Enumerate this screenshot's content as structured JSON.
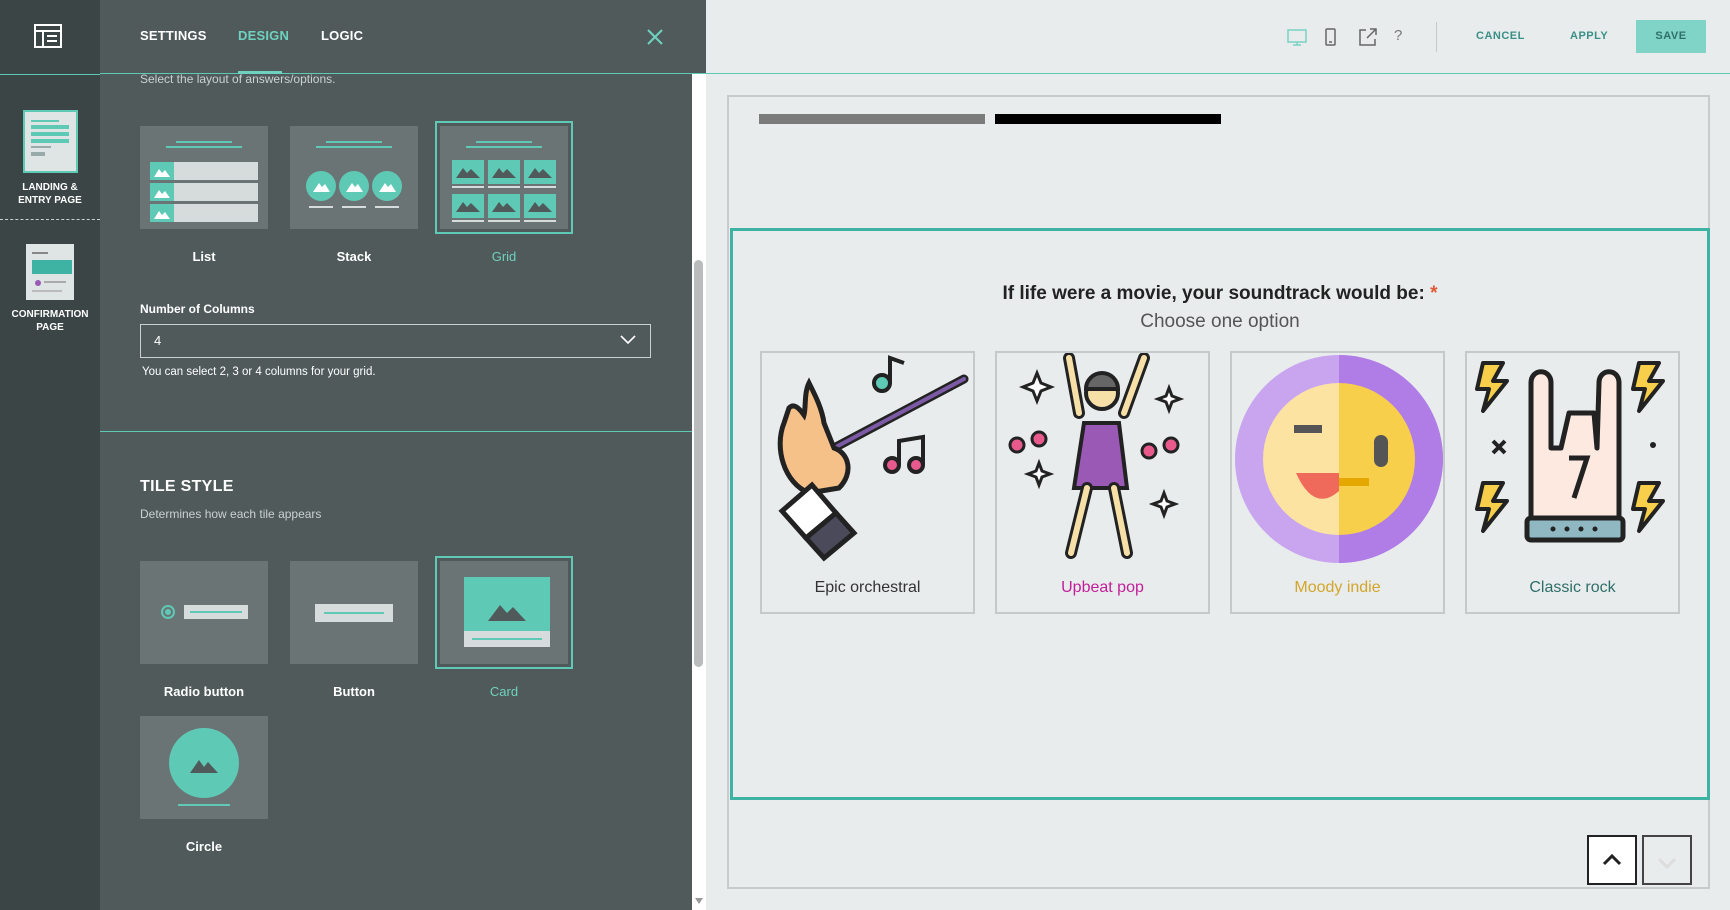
{
  "rail": {
    "pages": [
      {
        "label_line1": "LANDING &",
        "label_line2": "ENTRY PAGE"
      },
      {
        "label_line1": "CONFIRMATION",
        "label_line2": "PAGE"
      }
    ]
  },
  "panel": {
    "tabs": [
      "SETTINGS",
      "DESIGN",
      "LOGIC"
    ],
    "active_tab": "DESIGN",
    "layout_hint": "Select the layout of answers/options.",
    "layout_options": [
      "List",
      "Stack",
      "Grid"
    ],
    "layout_selected": "Grid",
    "columns_label": "Number of Columns",
    "columns_value": "4",
    "columns_help": "You can select 2, 3 or 4 columns for your grid.",
    "tile_style_title": "TILE STYLE",
    "tile_style_desc": "Determines how each tile appears",
    "tile_options": [
      "Radio button",
      "Button",
      "Card",
      "Circle"
    ],
    "tile_selected": "Card"
  },
  "topbar": {
    "cancel": "CANCEL",
    "apply": "APPLY",
    "save": "SAVE",
    "help": "?"
  },
  "preview": {
    "question": "If life were a movie, your soundtrack would be:",
    "required_mark": "*",
    "subtitle": "Choose one option",
    "answers": [
      {
        "label": "Epic orchestral",
        "color": "#333333"
      },
      {
        "label": "Upbeat pop",
        "color": "#c21f9a"
      },
      {
        "label": "Moody indie",
        "color": "#d4a52b"
      },
      {
        "label": "Classic rock",
        "color": "#2f6f6a"
      }
    ]
  },
  "colors": {
    "accent": "#5ec9b5",
    "panel_bg": "#505a5a",
    "rail_bg": "#3b4545",
    "save_bg": "#7fd3c7"
  }
}
